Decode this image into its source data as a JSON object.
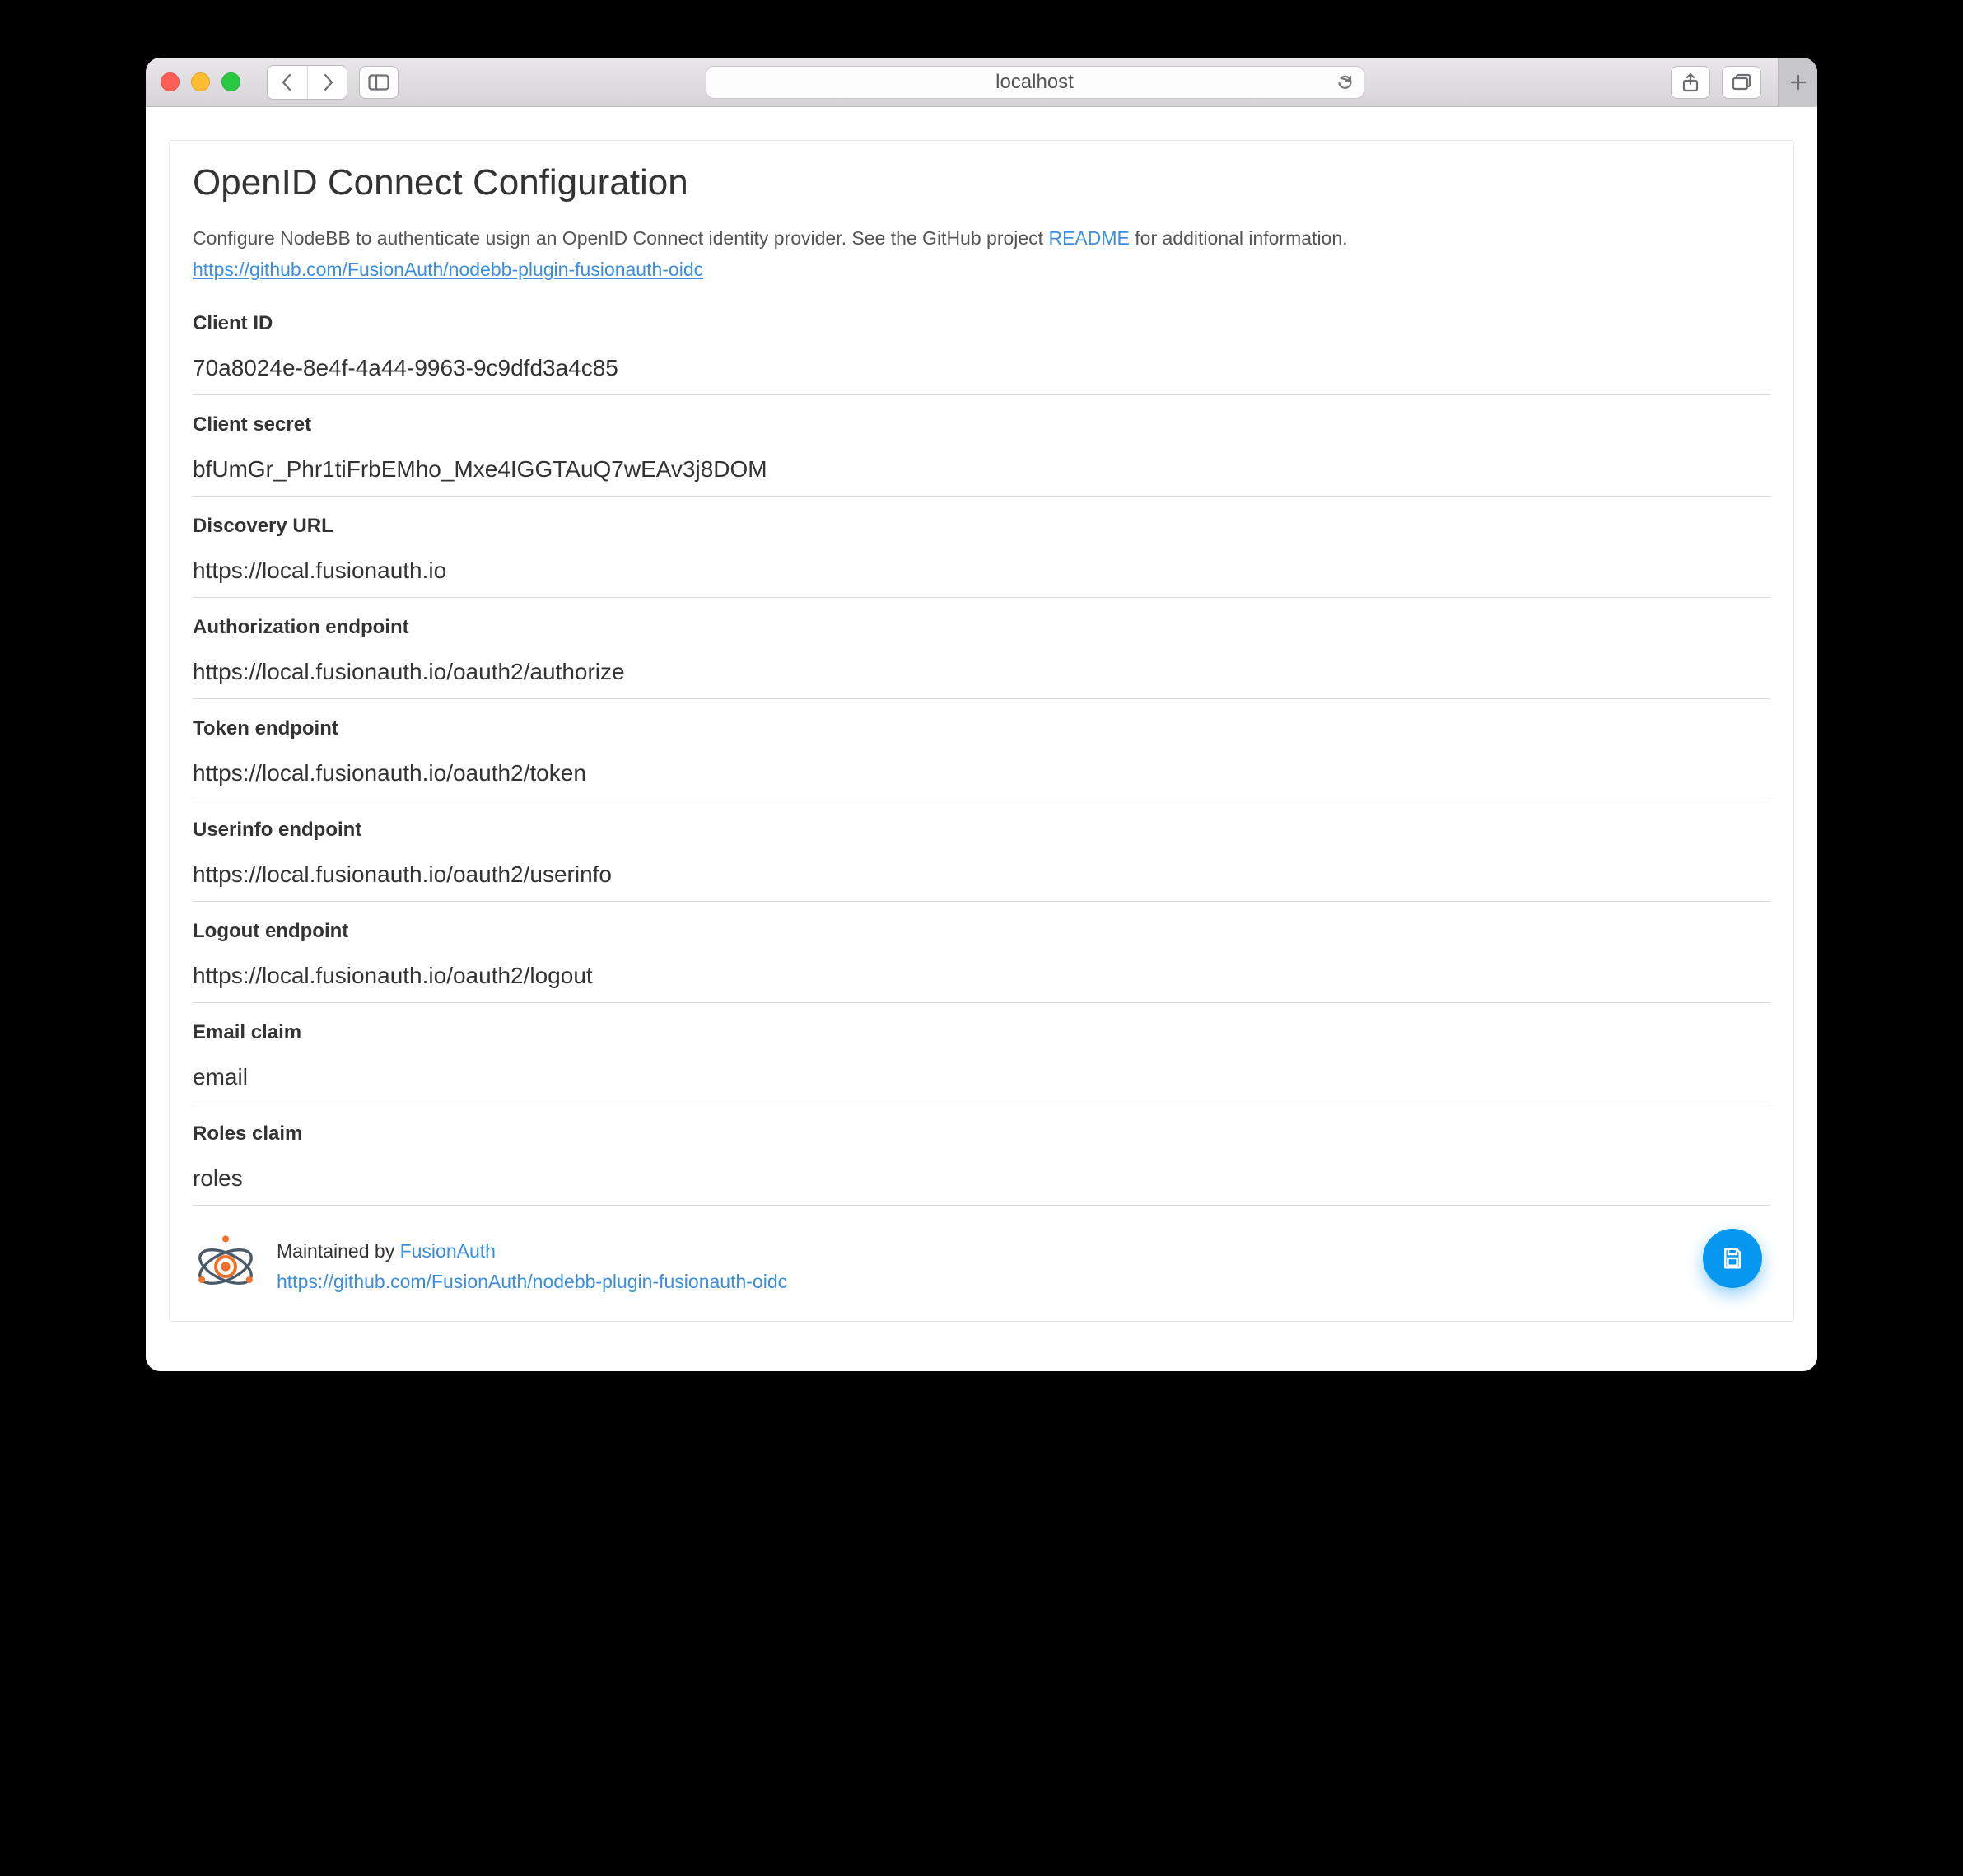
{
  "browser": {
    "address": "localhost"
  },
  "header": {
    "title": "OpenID Connect Configuration"
  },
  "intro": {
    "text_before": "Configure NodeBB to authenticate usign an OpenID Connect identity provider. See the GitHub project ",
    "link_label": "README",
    "text_after": " for additional information.",
    "repo_url": "https://github.com/FusionAuth/nodebb-plugin-fusionauth-oidc"
  },
  "fields": [
    {
      "label": "Client ID",
      "value": "70a8024e-8e4f-4a44-9963-9c9dfd3a4c85"
    },
    {
      "label": "Client secret",
      "value": "bfUmGr_Phr1tiFrbEMho_Mxe4IGGTAuQ7wEAv3j8DOM"
    },
    {
      "label": "Discovery URL",
      "value": "https://local.fusionauth.io"
    },
    {
      "label": "Authorization endpoint",
      "value": "https://local.fusionauth.io/oauth2/authorize"
    },
    {
      "label": "Token endpoint",
      "value": "https://local.fusionauth.io/oauth2/token"
    },
    {
      "label": "Userinfo endpoint",
      "value": "https://local.fusionauth.io/oauth2/userinfo"
    },
    {
      "label": "Logout endpoint",
      "value": "https://local.fusionauth.io/oauth2/logout"
    },
    {
      "label": "Email claim",
      "value": "email"
    },
    {
      "label": "Roles claim",
      "value": "roles"
    }
  ],
  "footer": {
    "maintained_by_text": "Maintained by ",
    "maintained_by_link": "FusionAuth",
    "repo_url": "https://github.com/FusionAuth/nodebb-plugin-fusionauth-oidc"
  }
}
